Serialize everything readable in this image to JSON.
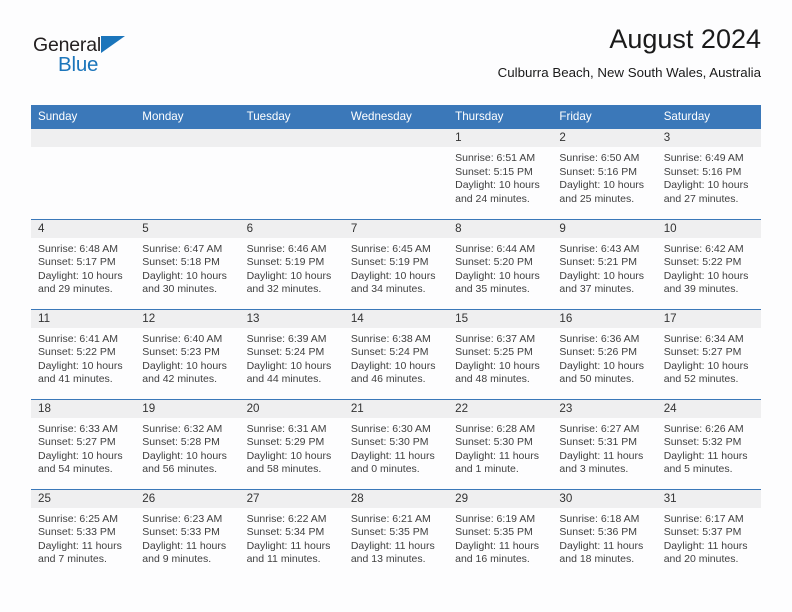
{
  "brand": {
    "name_top": "General",
    "name_bottom": "Blue",
    "accent_color": "#1b75bb"
  },
  "header": {
    "title": "August 2024",
    "subtitle": "Culburra Beach, New South Wales, Australia"
  },
  "colors": {
    "header_row_bg": "#3b78b9",
    "daynum_band_bg": "#efeff0",
    "page_bg": "#fdfdfe",
    "text": "#404040"
  },
  "weekday_headers": [
    "Sunday",
    "Monday",
    "Tuesday",
    "Wednesday",
    "Thursday",
    "Friday",
    "Saturday"
  ],
  "weeks": [
    [
      {
        "day": "",
        "empty": true
      },
      {
        "day": "",
        "empty": true
      },
      {
        "day": "",
        "empty": true
      },
      {
        "day": "",
        "empty": true
      },
      {
        "day": "1",
        "sunrise": "Sunrise: 6:51 AM",
        "sunset": "Sunset: 5:15 PM",
        "daylight_l1": "Daylight: 10 hours",
        "daylight_l2": "and 24 minutes."
      },
      {
        "day": "2",
        "sunrise": "Sunrise: 6:50 AM",
        "sunset": "Sunset: 5:16 PM",
        "daylight_l1": "Daylight: 10 hours",
        "daylight_l2": "and 25 minutes."
      },
      {
        "day": "3",
        "sunrise": "Sunrise: 6:49 AM",
        "sunset": "Sunset: 5:16 PM",
        "daylight_l1": "Daylight: 10 hours",
        "daylight_l2": "and 27 minutes."
      }
    ],
    [
      {
        "day": "4",
        "sunrise": "Sunrise: 6:48 AM",
        "sunset": "Sunset: 5:17 PM",
        "daylight_l1": "Daylight: 10 hours",
        "daylight_l2": "and 29 minutes."
      },
      {
        "day": "5",
        "sunrise": "Sunrise: 6:47 AM",
        "sunset": "Sunset: 5:18 PM",
        "daylight_l1": "Daylight: 10 hours",
        "daylight_l2": "and 30 minutes."
      },
      {
        "day": "6",
        "sunrise": "Sunrise: 6:46 AM",
        "sunset": "Sunset: 5:19 PM",
        "daylight_l1": "Daylight: 10 hours",
        "daylight_l2": "and 32 minutes."
      },
      {
        "day": "7",
        "sunrise": "Sunrise: 6:45 AM",
        "sunset": "Sunset: 5:19 PM",
        "daylight_l1": "Daylight: 10 hours",
        "daylight_l2": "and 34 minutes."
      },
      {
        "day": "8",
        "sunrise": "Sunrise: 6:44 AM",
        "sunset": "Sunset: 5:20 PM",
        "daylight_l1": "Daylight: 10 hours",
        "daylight_l2": "and 35 minutes."
      },
      {
        "day": "9",
        "sunrise": "Sunrise: 6:43 AM",
        "sunset": "Sunset: 5:21 PM",
        "daylight_l1": "Daylight: 10 hours",
        "daylight_l2": "and 37 minutes."
      },
      {
        "day": "10",
        "sunrise": "Sunrise: 6:42 AM",
        "sunset": "Sunset: 5:22 PM",
        "daylight_l1": "Daylight: 10 hours",
        "daylight_l2": "and 39 minutes."
      }
    ],
    [
      {
        "day": "11",
        "sunrise": "Sunrise: 6:41 AM",
        "sunset": "Sunset: 5:22 PM",
        "daylight_l1": "Daylight: 10 hours",
        "daylight_l2": "and 41 minutes."
      },
      {
        "day": "12",
        "sunrise": "Sunrise: 6:40 AM",
        "sunset": "Sunset: 5:23 PM",
        "daylight_l1": "Daylight: 10 hours",
        "daylight_l2": "and 42 minutes."
      },
      {
        "day": "13",
        "sunrise": "Sunrise: 6:39 AM",
        "sunset": "Sunset: 5:24 PM",
        "daylight_l1": "Daylight: 10 hours",
        "daylight_l2": "and 44 minutes."
      },
      {
        "day": "14",
        "sunrise": "Sunrise: 6:38 AM",
        "sunset": "Sunset: 5:24 PM",
        "daylight_l1": "Daylight: 10 hours",
        "daylight_l2": "and 46 minutes."
      },
      {
        "day": "15",
        "sunrise": "Sunrise: 6:37 AM",
        "sunset": "Sunset: 5:25 PM",
        "daylight_l1": "Daylight: 10 hours",
        "daylight_l2": "and 48 minutes."
      },
      {
        "day": "16",
        "sunrise": "Sunrise: 6:36 AM",
        "sunset": "Sunset: 5:26 PM",
        "daylight_l1": "Daylight: 10 hours",
        "daylight_l2": "and 50 minutes."
      },
      {
        "day": "17",
        "sunrise": "Sunrise: 6:34 AM",
        "sunset": "Sunset: 5:27 PM",
        "daylight_l1": "Daylight: 10 hours",
        "daylight_l2": "and 52 minutes."
      }
    ],
    [
      {
        "day": "18",
        "sunrise": "Sunrise: 6:33 AM",
        "sunset": "Sunset: 5:27 PM",
        "daylight_l1": "Daylight: 10 hours",
        "daylight_l2": "and 54 minutes."
      },
      {
        "day": "19",
        "sunrise": "Sunrise: 6:32 AM",
        "sunset": "Sunset: 5:28 PM",
        "daylight_l1": "Daylight: 10 hours",
        "daylight_l2": "and 56 minutes."
      },
      {
        "day": "20",
        "sunrise": "Sunrise: 6:31 AM",
        "sunset": "Sunset: 5:29 PM",
        "daylight_l1": "Daylight: 10 hours",
        "daylight_l2": "and 58 minutes."
      },
      {
        "day": "21",
        "sunrise": "Sunrise: 6:30 AM",
        "sunset": "Sunset: 5:30 PM",
        "daylight_l1": "Daylight: 11 hours",
        "daylight_l2": "and 0 minutes."
      },
      {
        "day": "22",
        "sunrise": "Sunrise: 6:28 AM",
        "sunset": "Sunset: 5:30 PM",
        "daylight_l1": "Daylight: 11 hours",
        "daylight_l2": "and 1 minute."
      },
      {
        "day": "23",
        "sunrise": "Sunrise: 6:27 AM",
        "sunset": "Sunset: 5:31 PM",
        "daylight_l1": "Daylight: 11 hours",
        "daylight_l2": "and 3 minutes."
      },
      {
        "day": "24",
        "sunrise": "Sunrise: 6:26 AM",
        "sunset": "Sunset: 5:32 PM",
        "daylight_l1": "Daylight: 11 hours",
        "daylight_l2": "and 5 minutes."
      }
    ],
    [
      {
        "day": "25",
        "sunrise": "Sunrise: 6:25 AM",
        "sunset": "Sunset: 5:33 PM",
        "daylight_l1": "Daylight: 11 hours",
        "daylight_l2": "and 7 minutes."
      },
      {
        "day": "26",
        "sunrise": "Sunrise: 6:23 AM",
        "sunset": "Sunset: 5:33 PM",
        "daylight_l1": "Daylight: 11 hours",
        "daylight_l2": "and 9 minutes."
      },
      {
        "day": "27",
        "sunrise": "Sunrise: 6:22 AM",
        "sunset": "Sunset: 5:34 PM",
        "daylight_l1": "Daylight: 11 hours",
        "daylight_l2": "and 11 minutes."
      },
      {
        "day": "28",
        "sunrise": "Sunrise: 6:21 AM",
        "sunset": "Sunset: 5:35 PM",
        "daylight_l1": "Daylight: 11 hours",
        "daylight_l2": "and 13 minutes."
      },
      {
        "day": "29",
        "sunrise": "Sunrise: 6:19 AM",
        "sunset": "Sunset: 5:35 PM",
        "daylight_l1": "Daylight: 11 hours",
        "daylight_l2": "and 16 minutes."
      },
      {
        "day": "30",
        "sunrise": "Sunrise: 6:18 AM",
        "sunset": "Sunset: 5:36 PM",
        "daylight_l1": "Daylight: 11 hours",
        "daylight_l2": "and 18 minutes."
      },
      {
        "day": "31",
        "sunrise": "Sunrise: 6:17 AM",
        "sunset": "Sunset: 5:37 PM",
        "daylight_l1": "Daylight: 11 hours",
        "daylight_l2": "and 20 minutes."
      }
    ]
  ]
}
